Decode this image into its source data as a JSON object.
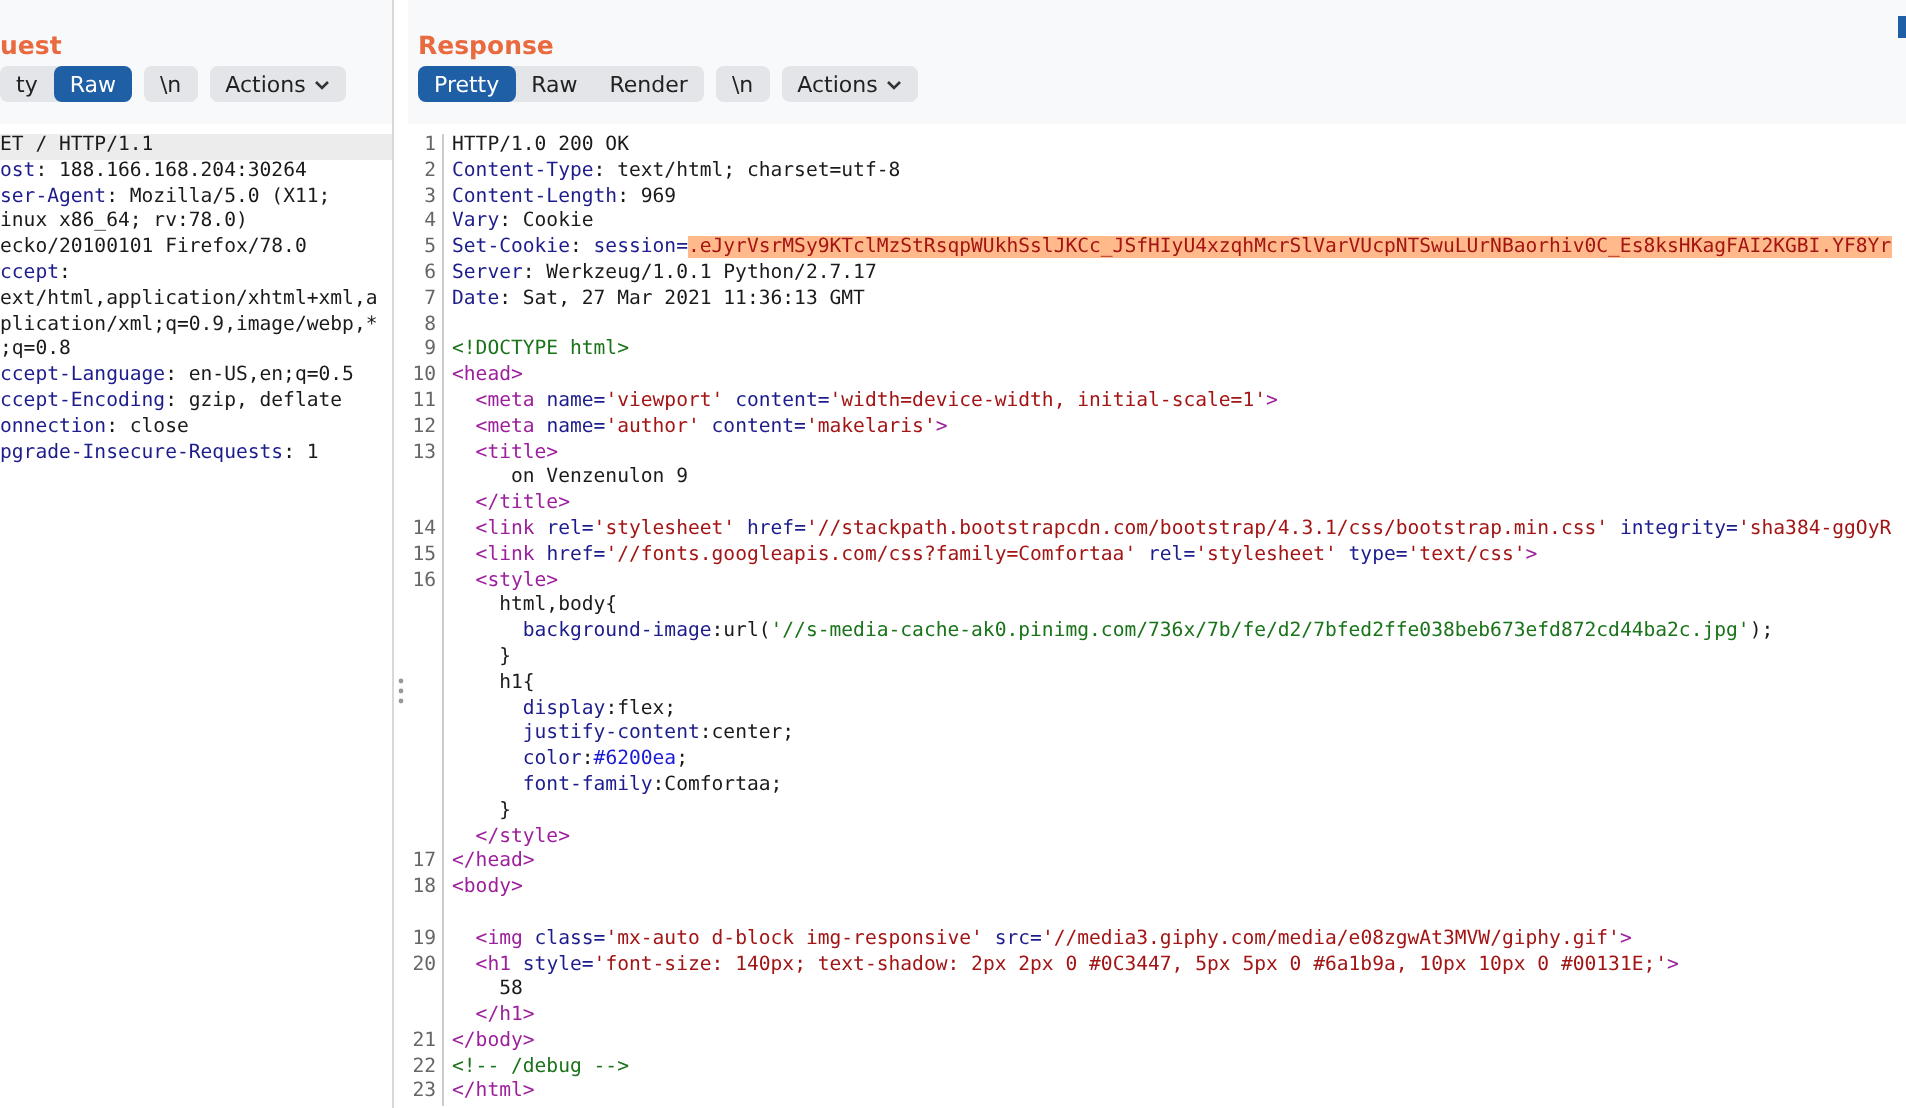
{
  "request": {
    "title": "uest",
    "view_tabs": [
      {
        "label": "ty",
        "selected": false
      },
      {
        "label": "Raw",
        "selected": true
      }
    ],
    "newline_toggle": "\\n",
    "actions": "Actions",
    "lines": [
      {
        "selected": true,
        "segments": [
          {
            "kind": "plain",
            "text": "ET / HTTP/1.1"
          }
        ]
      },
      {
        "selected": false,
        "segments": [
          {
            "kind": "key",
            "text": "ost"
          },
          {
            "kind": "plain",
            "text": ": 188.166.168.204:30264"
          }
        ]
      },
      {
        "selected": false,
        "segments": [
          {
            "kind": "key",
            "text": "ser-Agent"
          },
          {
            "kind": "plain",
            "text": ": Mozilla/5.0 (X11;"
          }
        ]
      },
      {
        "selected": false,
        "segments": [
          {
            "kind": "plain",
            "text": "inux x86_64; rv:78.0)"
          }
        ]
      },
      {
        "selected": false,
        "segments": [
          {
            "kind": "plain",
            "text": "ecko/20100101 Firefox/78.0"
          }
        ]
      },
      {
        "selected": false,
        "segments": [
          {
            "kind": "key",
            "text": "ccept"
          },
          {
            "kind": "plain",
            "text": ":"
          }
        ]
      },
      {
        "selected": false,
        "segments": [
          {
            "kind": "plain",
            "text": "ext/html,application/xhtml+xml,a"
          }
        ]
      },
      {
        "selected": false,
        "segments": [
          {
            "kind": "plain",
            "text": "plication/xml;q=0.9,image/webp,*"
          }
        ]
      },
      {
        "selected": false,
        "segments": [
          {
            "kind": "plain",
            "text": ";q=0.8"
          }
        ]
      },
      {
        "selected": false,
        "segments": [
          {
            "kind": "key",
            "text": "ccept-Language"
          },
          {
            "kind": "plain",
            "text": ": en-US,en;q=0.5"
          }
        ]
      },
      {
        "selected": false,
        "segments": [
          {
            "kind": "key",
            "text": "ccept-Encoding"
          },
          {
            "kind": "plain",
            "text": ": gzip, deflate"
          }
        ]
      },
      {
        "selected": false,
        "segments": [
          {
            "kind": "key",
            "text": "onnection"
          },
          {
            "kind": "plain",
            "text": ": close"
          }
        ]
      },
      {
        "selected": false,
        "segments": [
          {
            "kind": "key",
            "text": "pgrade-Insecure-Requests"
          },
          {
            "kind": "plain",
            "text": ": 1"
          }
        ]
      }
    ]
  },
  "response": {
    "title": "Response",
    "view_tabs": [
      {
        "label": "Pretty",
        "selected": true
      },
      {
        "label": "Raw",
        "selected": false
      },
      {
        "label": "Render",
        "selected": false
      }
    ],
    "newline_toggle": "\\n",
    "actions": "Actions",
    "lines": [
      {
        "number": "1",
        "selected": false,
        "segments": [
          {
            "kind": "plain",
            "text": "HTTP/1.0 200 OK"
          }
        ]
      },
      {
        "number": "2",
        "selected": false,
        "segments": [
          {
            "kind": "key",
            "text": "Content-Type"
          },
          {
            "kind": "plain",
            "text": ": text/html; charset=utf-8"
          }
        ]
      },
      {
        "number": "3",
        "selected": false,
        "segments": [
          {
            "kind": "key",
            "text": "Content-Length"
          },
          {
            "kind": "plain",
            "text": ": 969"
          }
        ]
      },
      {
        "number": "4",
        "selected": false,
        "segments": [
          {
            "kind": "key",
            "text": "Vary"
          },
          {
            "kind": "plain",
            "text": ": Cookie"
          }
        ]
      },
      {
        "number": "5",
        "selected": false,
        "segments": [
          {
            "kind": "key",
            "text": "Set-Cookie"
          },
          {
            "kind": "plain",
            "text": ": "
          },
          {
            "kind": "attr",
            "text": "session="
          },
          {
            "kind": "highlight",
            "text": ".eJyrVsrMSy9KTclMzStRsqpWUkhSslJKCc_JSfHIyU4xzqhMcrSlVarVUcpNTSwuLUrNBaorhiv0C_Es8ksHKagFAI2KGBI.YF8Yr"
          }
        ]
      },
      {
        "number": "6",
        "selected": false,
        "segments": [
          {
            "kind": "key",
            "text": "Server"
          },
          {
            "kind": "plain",
            "text": ": Werkzeug/1.0.1 Python/2.7.17"
          }
        ]
      },
      {
        "number": "7",
        "selected": false,
        "segments": [
          {
            "kind": "key",
            "text": "Date"
          },
          {
            "kind": "plain",
            "text": ": Sat, 27 Mar 2021 11:36:13 GMT"
          }
        ]
      },
      {
        "number": "8",
        "selected": false
      },
      {
        "number": "9",
        "selected": false,
        "segments": [
          {
            "kind": "string",
            "text": "<!DOCTYPE html>"
          }
        ]
      },
      {
        "number": "10",
        "selected": false,
        "segments": [
          {
            "kind": "tag",
            "text": "<head>"
          }
        ]
      },
      {
        "number": "11",
        "selected": false,
        "segments": [
          {
            "kind": "tag",
            "text": "  <meta"
          },
          {
            "kind": "attr",
            "text": " name="
          },
          {
            "kind": "value",
            "text": "'viewport'"
          },
          {
            "kind": "attr",
            "text": " content="
          },
          {
            "kind": "value",
            "text": "'width=device-width, initial-scale=1'"
          },
          {
            "kind": "tag",
            "text": ">"
          }
        ]
      },
      {
        "number": "12",
        "selected": false,
        "segments": [
          {
            "kind": "tag",
            "text": "  <meta"
          },
          {
            "kind": "attr",
            "text": " name="
          },
          {
            "kind": "value",
            "text": "'author'"
          },
          {
            "kind": "attr",
            "text": " content="
          },
          {
            "kind": "value",
            "text": "'makelaris'"
          },
          {
            "kind": "tag",
            "text": ">"
          }
        ]
      },
      {
        "number": "13",
        "selected": false,
        "segments": [
          {
            "kind": "tag",
            "text": "  <title>"
          }
        ]
      },
      {
        "selected": false,
        "segments": [
          {
            "kind": "plain",
            "text": "     on Venzenulon 9"
          }
        ]
      },
      {
        "selected": false,
        "segments": [
          {
            "kind": "tag",
            "text": "  </title>"
          }
        ]
      },
      {
        "number": "14",
        "selected": false,
        "segments": [
          {
            "kind": "tag",
            "text": "  <link"
          },
          {
            "kind": "attr",
            "text": " rel="
          },
          {
            "kind": "value",
            "text": "'stylesheet'"
          },
          {
            "kind": "attr",
            "text": " href="
          },
          {
            "kind": "value",
            "text": "'//stackpath.bootstrapcdn.com/bootstrap/4.3.1/css/bootstrap.min.css'"
          },
          {
            "kind": "attr",
            "text": " integrity="
          },
          {
            "kind": "value",
            "text": "'sha384-ggOyR"
          }
        ]
      },
      {
        "number": "15",
        "selected": false,
        "segments": [
          {
            "kind": "tag",
            "text": "  <link"
          },
          {
            "kind": "attr",
            "text": " href="
          },
          {
            "kind": "value",
            "text": "'//fonts.googleapis.com/css?family=Comfortaa'"
          },
          {
            "kind": "attr",
            "text": " rel="
          },
          {
            "kind": "value",
            "text": "'stylesheet'"
          },
          {
            "kind": "attr",
            "text": " type="
          },
          {
            "kind": "value",
            "text": "'text/css'"
          },
          {
            "kind": "tag",
            "text": ">"
          }
        ]
      },
      {
        "number": "16",
        "selected": false,
        "segments": [
          {
            "kind": "tag",
            "text": "  <style>"
          }
        ]
      },
      {
        "selected": false,
        "segments": [
          {
            "kind": "plain",
            "text": "    html,body{"
          }
        ]
      },
      {
        "selected": false,
        "segments": [
          {
            "kind": "prop",
            "text": "      background-image"
          },
          {
            "kind": "plain",
            "text": ":url("
          },
          {
            "kind": "string",
            "text": "'//s-media-cache-ak0.pinimg.com/736x/7b/fe/d2/7bfed2ffe038beb673efd872cd44ba2c.jpg'"
          },
          {
            "kind": "plain",
            "text": ");"
          }
        ]
      },
      {
        "selected": false,
        "segments": [
          {
            "kind": "plain",
            "text": "    }"
          }
        ]
      },
      {
        "selected": false,
        "segments": [
          {
            "kind": "plain",
            "text": "    h1{"
          }
        ]
      },
      {
        "selected": false,
        "segments": [
          {
            "kind": "prop",
            "text": "      display"
          },
          {
            "kind": "plain",
            "text": ":flex;"
          }
        ]
      },
      {
        "selected": false,
        "segments": [
          {
            "kind": "prop",
            "text": "      justify-content"
          },
          {
            "kind": "plain",
            "text": ":center;"
          }
        ]
      },
      {
        "selected": false,
        "segments": [
          {
            "kind": "prop",
            "text": "      color"
          },
          {
            "kind": "plain",
            "text": ":"
          },
          {
            "kind": "hex",
            "text": "#6200ea"
          },
          {
            "kind": "plain",
            "text": ";"
          }
        ]
      },
      {
        "selected": false,
        "segments": [
          {
            "kind": "prop",
            "text": "      font-family"
          },
          {
            "kind": "plain",
            "text": ":Comfortaa;"
          }
        ]
      },
      {
        "selected": false,
        "segments": [
          {
            "kind": "plain",
            "text": "    }"
          }
        ]
      },
      {
        "selected": false,
        "segments": [
          {
            "kind": "tag",
            "text": "  </style>"
          }
        ]
      },
      {
        "number": "17",
        "selected": false,
        "segments": [
          {
            "kind": "tag",
            "text": "</head>"
          }
        ]
      },
      {
        "number": "18",
        "selected": false,
        "segments": [
          {
            "kind": "tag",
            "text": "<body>"
          }
        ]
      },
      {
        "selected": false
      },
      {
        "number": "19",
        "selected": false,
        "segments": [
          {
            "kind": "tag",
            "text": "  <img"
          },
          {
            "kind": "attr",
            "text": " class="
          },
          {
            "kind": "value",
            "text": "'mx-auto d-block img-responsive'"
          },
          {
            "kind": "attr",
            "text": " src="
          },
          {
            "kind": "value",
            "text": "'//media3.giphy.com/media/e08zgwAt3MVW/giphy.gif'"
          },
          {
            "kind": "tag",
            "text": ">"
          }
        ]
      },
      {
        "number": "20",
        "selected": false,
        "segments": [
          {
            "kind": "tag",
            "text": "  <h1"
          },
          {
            "kind": "attr",
            "text": " style="
          },
          {
            "kind": "value",
            "text": "'font-size: 140px; text-shadow: 2px 2px 0 #0C3447, 5px 5px 0 #6a1b9a, 10px 10px 0 #00131E;'"
          },
          {
            "kind": "tag",
            "text": ">"
          }
        ]
      },
      {
        "selected": false,
        "segments": [
          {
            "kind": "plain",
            "text": "    58"
          }
        ]
      },
      {
        "selected": false,
        "segments": [
          {
            "kind": "tag",
            "text": "  </h1>"
          }
        ]
      },
      {
        "number": "21",
        "selected": false,
        "segments": [
          {
            "kind": "tag",
            "text": "</body>"
          }
        ]
      },
      {
        "number": "22",
        "selected": false,
        "segments": [
          {
            "kind": "string",
            "text": "<!-- /debug -->"
          }
        ]
      },
      {
        "number": "23",
        "selected": false,
        "segments": [
          {
            "kind": "tag",
            "text": "</html>"
          }
        ]
      }
    ]
  }
}
